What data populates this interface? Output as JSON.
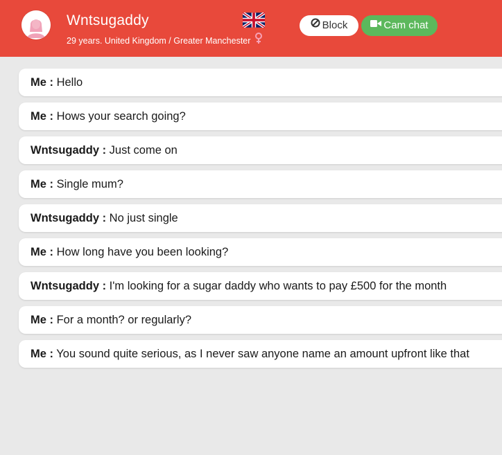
{
  "header": {
    "username": "Wntsugaddy",
    "subinfo": "29 years. United Kingdom / Greater Manchester",
    "avatar_icon": "female-avatar-icon",
    "flag_icon": "uk-flag-icon",
    "gender_icon": "female-symbol-icon",
    "block_label": "Block",
    "block_icon": "ban-icon",
    "cam_label": "Cam chat",
    "cam_icon": "video-camera-icon",
    "colors": {
      "header_bg": "#e8493b",
      "cam_green": "#5cb85c",
      "gender_pink": "#f7a1b6"
    }
  },
  "messages": [
    {
      "sender": "Me :",
      "text": "Hello"
    },
    {
      "sender": "Me :",
      "text": "Hows your search going?"
    },
    {
      "sender": "Wntsugaddy :",
      "text": "Just come on"
    },
    {
      "sender": "Me :",
      "text": "Single mum?"
    },
    {
      "sender": "Wntsugaddy :",
      "text": "No just single"
    },
    {
      "sender": "Me :",
      "text": "How long have you been looking?"
    },
    {
      "sender": "Wntsugaddy :",
      "text": "I'm looking for a sugar daddy who wants to pay £500 for the month"
    },
    {
      "sender": "Me :",
      "text": "For a month? or regularly?"
    },
    {
      "sender": "Me :",
      "text": "You sound quite serious, as I never saw anyone name an amount upfront like that"
    }
  ]
}
